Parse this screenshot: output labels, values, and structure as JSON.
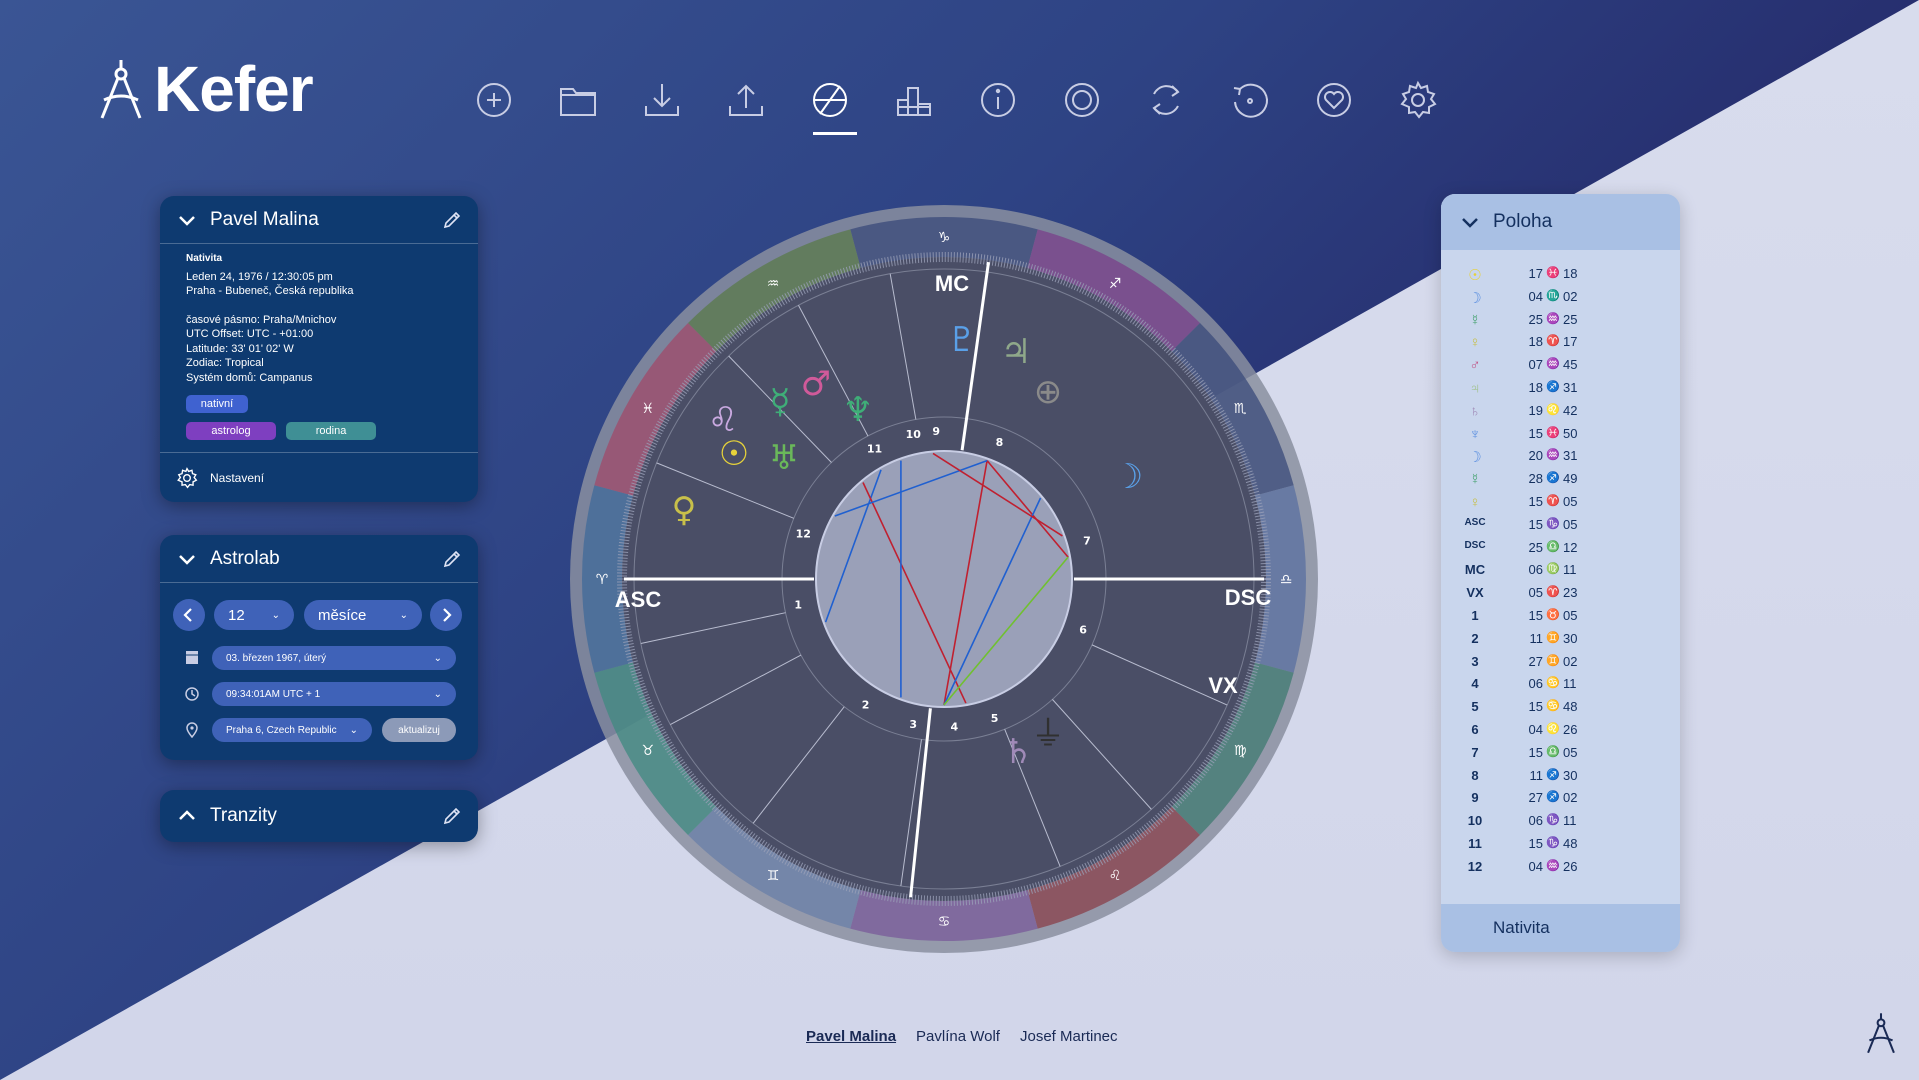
{
  "app": {
    "name": "Kefer"
  },
  "toolbar": {
    "items": [
      {
        "icon": "plus-circle-icon"
      },
      {
        "icon": "folder-icon"
      },
      {
        "icon": "download-icon"
      },
      {
        "icon": "upload-icon"
      },
      {
        "icon": "chart-wheel-icon",
        "active": true
      },
      {
        "icon": "bar-stats-icon"
      },
      {
        "icon": "info-icon"
      },
      {
        "icon": "rings-icon"
      },
      {
        "icon": "refresh-icon"
      },
      {
        "icon": "rotate-target-icon"
      },
      {
        "icon": "heart-icon"
      },
      {
        "icon": "gear-icon"
      }
    ]
  },
  "person_panel": {
    "name": "Pavel Malina",
    "kind": "Nativita",
    "date": "Leden 24, 1976 / 12:30:05 pm",
    "place": "Praha - Bubeneč, Česká republika",
    "timezone": "časové pásmo: Praha/Mnichov",
    "utc_offset": "UTC Offset: UTC - +01:00",
    "latitude": "Latitude: 33' 01' 02' W",
    "zodiac": "Zodiac: Tropical",
    "house_system": "Systém domů: Campanus",
    "tags": [
      {
        "label": "nativní",
        "color": "#3f62d0"
      },
      {
        "label": "astrolog",
        "color": "#7e3fc0"
      },
      {
        "label": "rodina",
        "color": "#3f8f95"
      }
    ],
    "settings_label": "Nastavení"
  },
  "astrolab_panel": {
    "title": "Astrolab",
    "step_value": "12",
    "step_unit": "měsíce",
    "date_value": "03. březen 1967, úterý",
    "time_value": "09:34:01AM  UTC + 1",
    "place_value": "Praha 6, Czech Republic",
    "update_label": "aktualizuj"
  },
  "tranzity_panel": {
    "title": "Tranzity"
  },
  "poloha_panel": {
    "title": "Poloha",
    "footer": "Nativita",
    "rows": [
      {
        "label": "☉",
        "deg": "17",
        "sign": "♓",
        "min": "18",
        "color": "#e6d23a"
      },
      {
        "label": "☽",
        "deg": "04",
        "sign": "♏",
        "min": "02",
        "color": "#5a8fe0"
      },
      {
        "label": "☿",
        "deg": "25",
        "sign": "♒",
        "min": "25",
        "color": "#3f9f6a"
      },
      {
        "label": "♀",
        "deg": "18",
        "sign": "♈",
        "min": "17",
        "color": "#c8c04a"
      },
      {
        "label": "♂",
        "deg": "07",
        "sign": "♒",
        "min": "45",
        "color": "#c05a8a"
      },
      {
        "label": "♃",
        "deg": "18",
        "sign": "♐",
        "min": "31",
        "color": "#9fc08a"
      },
      {
        "label": "♄",
        "deg": "19",
        "sign": "♌",
        "min": "42",
        "color": "#a08ab8"
      },
      {
        "label": "♆",
        "deg": "15",
        "sign": "♓",
        "min": "50",
        "color": "#5a8fe0"
      },
      {
        "label": "☽",
        "deg": "20",
        "sign": "♒",
        "min": "31",
        "color": "#5a8fe0"
      },
      {
        "label": "☿",
        "deg": "28",
        "sign": "♐",
        "min": "49",
        "color": "#3f9f6a"
      },
      {
        "label": "♀",
        "deg": "15",
        "sign": "♈",
        "min": "05",
        "color": "#c8c04a"
      },
      {
        "label": "ASC",
        "deg": "15",
        "sign": "♑",
        "min": "05",
        "color": "#14305f"
      },
      {
        "label": "DSC",
        "deg": "25",
        "sign": "♎",
        "min": "12",
        "color": "#14305f"
      },
      {
        "label": "MC",
        "deg": "06",
        "sign": "♍",
        "min": "11",
        "color": "#14305f"
      },
      {
        "label": "VX",
        "deg": "05",
        "sign": "♈",
        "min": "23",
        "color": "#14305f"
      },
      {
        "label": "1",
        "deg": "15",
        "sign": "♉",
        "min": "05",
        "color": "#14305f"
      },
      {
        "label": "2",
        "deg": "11",
        "sign": "♊",
        "min": "30",
        "color": "#14305f"
      },
      {
        "label": "3",
        "deg": "27",
        "sign": "♊",
        "min": "02",
        "color": "#14305f"
      },
      {
        "label": "4",
        "deg": "06",
        "sign": "♋",
        "min": "11",
        "color": "#14305f"
      },
      {
        "label": "5",
        "deg": "15",
        "sign": "♋",
        "min": "48",
        "color": "#14305f"
      },
      {
        "label": "6",
        "deg": "04",
        "sign": "♌",
        "min": "26",
        "color": "#14305f"
      },
      {
        "label": "7",
        "deg": "15",
        "sign": "♎",
        "min": "05",
        "color": "#14305f"
      },
      {
        "label": "8",
        "deg": "11",
        "sign": "♐",
        "min": "30",
        "color": "#14305f"
      },
      {
        "label": "9",
        "deg": "27",
        "sign": "♐",
        "min": "02",
        "color": "#14305f"
      },
      {
        "label": "10",
        "deg": "06",
        "sign": "♑",
        "min": "11",
        "color": "#14305f"
      },
      {
        "label": "11",
        "deg": "15",
        "sign": "♑",
        "min": "48",
        "color": "#14305f"
      },
      {
        "label": "12",
        "deg": "04",
        "sign": "♒",
        "min": "26",
        "color": "#14305f"
      }
    ]
  },
  "chart": {
    "angles": {
      "asc": "ASC",
      "dsc": "DSC",
      "mc": "MC",
      "vx": "VX"
    },
    "house_numbers": [
      "1",
      "2",
      "3",
      "4",
      "5",
      "6",
      "7",
      "8",
      "9",
      "10",
      "11",
      "12"
    ],
    "zodiac_signs": [
      "♑",
      "♐",
      "♏",
      "♎",
      "♍",
      "♌",
      "♋",
      "♊",
      "♉",
      "♈",
      "♓",
      "♒"
    ],
    "planets": [
      {
        "glyph": "♂",
        "color": "#d05a9a"
      },
      {
        "glyph": "☿",
        "color": "#3fae78"
      },
      {
        "glyph": "♆",
        "color": "#3fae78"
      },
      {
        "glyph": "♌",
        "color": "#c9a9e0"
      },
      {
        "glyph": "☉",
        "color": "#e6d23a"
      },
      {
        "glyph": "♅",
        "color": "#6ab85a"
      },
      {
        "glyph": "♇",
        "color": "#5aa0e8"
      },
      {
        "glyph": "♃",
        "color": "#8fa88a"
      },
      {
        "glyph": "⊕",
        "color": "#8a8a8a"
      },
      {
        "glyph": "☽",
        "color": "#5aa0e8"
      },
      {
        "glyph": "♀",
        "color": "#c8c04a"
      },
      {
        "glyph": "♄",
        "color": "#a08ab8"
      },
      {
        "glyph": "⏚",
        "color": "#303030"
      }
    ]
  },
  "bottom_people": [
    "Pavel Malina",
    "Pavlína Wolf",
    "Josef Martinec"
  ]
}
